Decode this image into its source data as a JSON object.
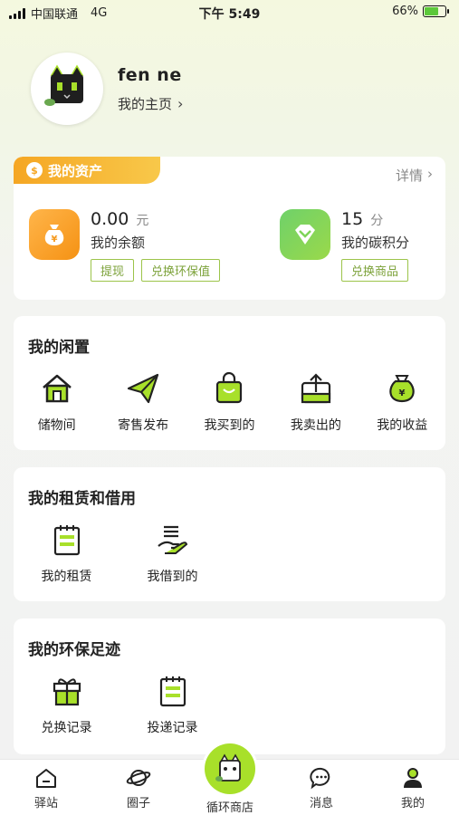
{
  "status_bar": {
    "carrier": "中国联通",
    "network": "4G",
    "time": "下午 5:49",
    "battery": "66%",
    "battery_level": 0.66
  },
  "profile": {
    "name": "fen ne",
    "homepage_label": "我的主页",
    "avatar_icon": "black-cat-avatar"
  },
  "assets": {
    "title": "我的资产",
    "detail_label": "详情",
    "balance": {
      "value": "0.00",
      "unit": "元",
      "label": "我的余额",
      "buttons": [
        "提现",
        "兑换环保值"
      ],
      "icon": "money-bag-icon"
    },
    "carbon": {
      "value": "15",
      "unit": "分",
      "label": "我的碳积分",
      "buttons": [
        "兑换商品"
      ],
      "icon": "diamond-icon"
    }
  },
  "idle": {
    "title": "我的闲置",
    "items": [
      {
        "label": "储物间",
        "icon": "house-icon"
      },
      {
        "label": "寄售发布",
        "icon": "paper-plane-icon"
      },
      {
        "label": "我买到的",
        "icon": "shopping-bag-icon"
      },
      {
        "label": "我卖出的",
        "icon": "outbox-icon"
      },
      {
        "label": "我的收益",
        "icon": "money-bag-icon"
      }
    ]
  },
  "rent": {
    "title": "我的租赁和借用",
    "items": [
      {
        "label": "我的租赁",
        "icon": "notepad-icon"
      },
      {
        "label": "我借到的",
        "icon": "hand-coins-icon"
      }
    ]
  },
  "footprint": {
    "title": "我的环保足迹",
    "items": [
      {
        "label": "兑换记录",
        "icon": "gift-icon"
      },
      {
        "label": "投递记录",
        "icon": "notepad-icon"
      }
    ]
  },
  "tabbar": {
    "items": [
      {
        "label": "驿站",
        "icon": "home-icon"
      },
      {
        "label": "圈子",
        "icon": "planet-icon"
      },
      {
        "label": "循环商店",
        "icon": "cat-store-icon"
      },
      {
        "label": "消息",
        "icon": "chat-icon"
      },
      {
        "label": "我的",
        "icon": "person-icon"
      }
    ]
  },
  "colors": {
    "accent_green": "#a8e02a",
    "orange": "#f5a623",
    "tag_green": "#9cc44a"
  }
}
